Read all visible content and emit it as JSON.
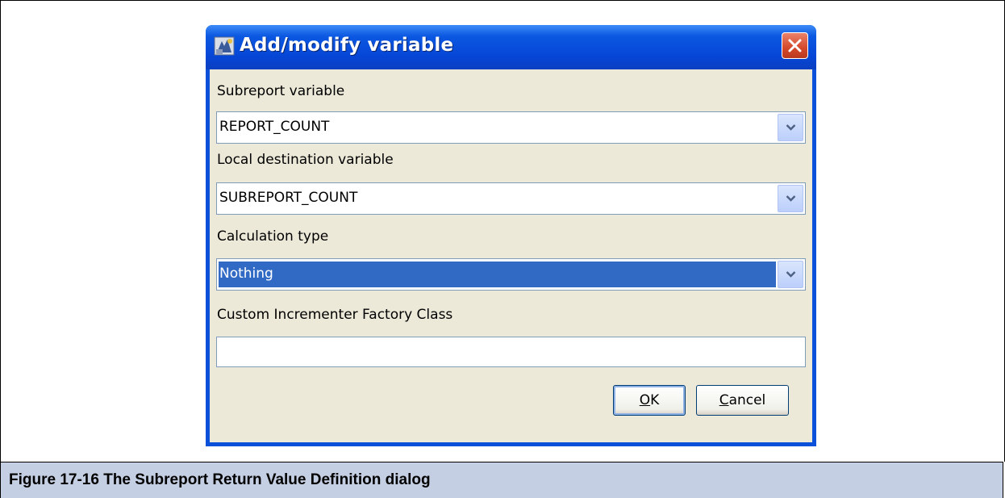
{
  "dialog": {
    "title": "Add/modify variable",
    "subreport_variable_label": "Subreport variable",
    "subreport_variable_value": "REPORT_COUNT",
    "local_destination_label": "Local destination variable",
    "local_destination_value": "SUBREPORT_COUNT",
    "calculation_type_label": "Calculation type",
    "calculation_type_value": "Nothing",
    "incrementer_label": "Custom Incrementer Factory Class",
    "incrementer_value": "",
    "ok_mnemonic": "O",
    "ok_rest": "K",
    "cancel_mnemonic": "C",
    "cancel_rest": "ancel"
  },
  "caption": "Figure 17-16  The Subreport Return Value Definition dialog",
  "icons": {
    "app": "app-icon",
    "close": "close-icon",
    "dropdown": "chevron-down-icon"
  },
  "colors": {
    "title_bar": "#0646d6",
    "dialog_bg": "#ece9d8",
    "selection": "#316ac5",
    "caption_bg": "#c5cfe3"
  }
}
